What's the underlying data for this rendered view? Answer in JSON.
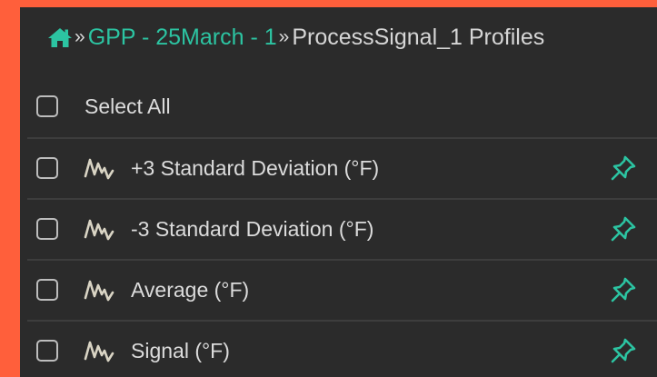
{
  "colors": {
    "background": "#ff5f3b",
    "panel": "#2b2b2b",
    "accent": "#2cc4a2",
    "text": "#dcdcdc"
  },
  "breadcrumb": {
    "home_icon": "home-icon",
    "separator": "»",
    "link": "GPP - 25March - 1",
    "current": "ProcessSignal_1 Profiles"
  },
  "select_all": {
    "label": "Select All",
    "checked": false
  },
  "items": [
    {
      "label": "+3 Standard Deviation (°F)",
      "icon": "signal-icon",
      "checked": false,
      "pinned": true
    },
    {
      "label": "-3 Standard Deviation (°F)",
      "icon": "signal-icon",
      "checked": false,
      "pinned": true
    },
    {
      "label": "Average (°F)",
      "icon": "signal-icon",
      "checked": false,
      "pinned": true
    },
    {
      "label": "Signal (°F)",
      "icon": "signal-icon",
      "checked": false,
      "pinned": true
    }
  ]
}
